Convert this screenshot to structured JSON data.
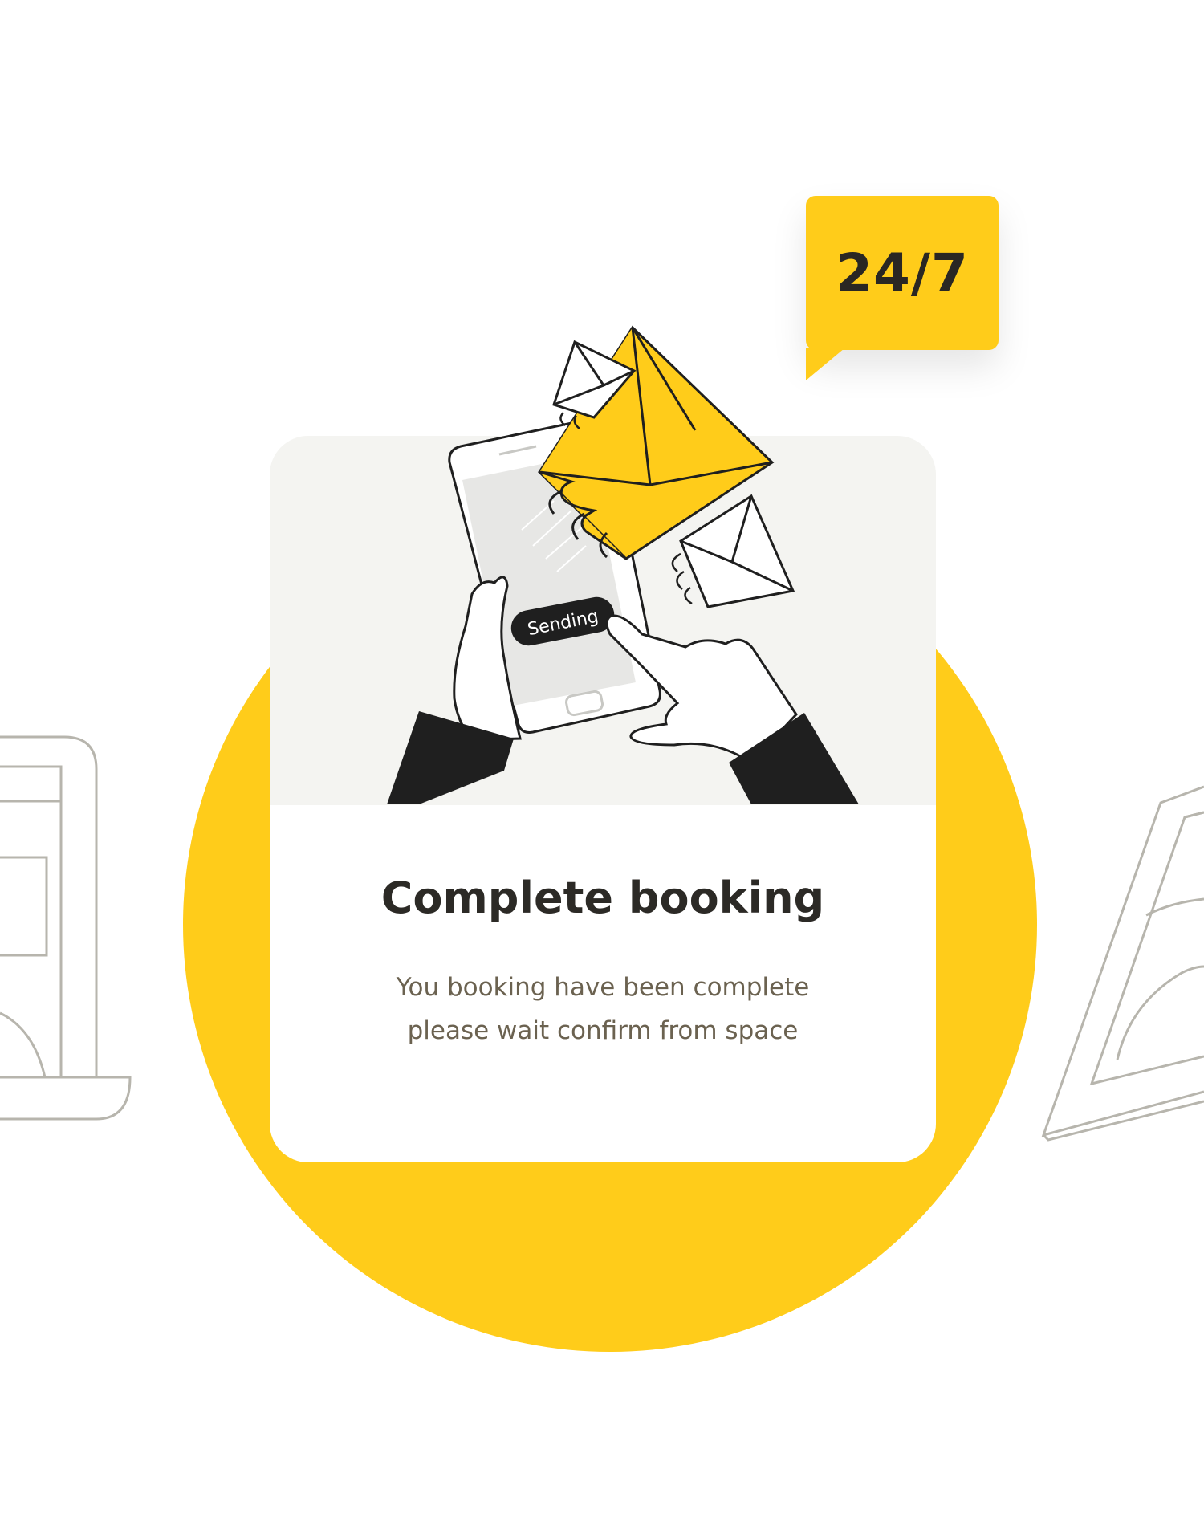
{
  "badge": {
    "text": "24/7"
  },
  "illustration": {
    "button_label": "Sending"
  },
  "card": {
    "title": "Complete booking",
    "body_line1": "You booking have been complete",
    "body_line2": "please wait confirm from space"
  },
  "colors": {
    "accent_yellow": "#ffcc1a",
    "text_dark": "#2c2a26",
    "text_muted": "#6b6250",
    "outline_gray": "#b7b5ad",
    "illustration_bg": "#f4f4f1"
  }
}
